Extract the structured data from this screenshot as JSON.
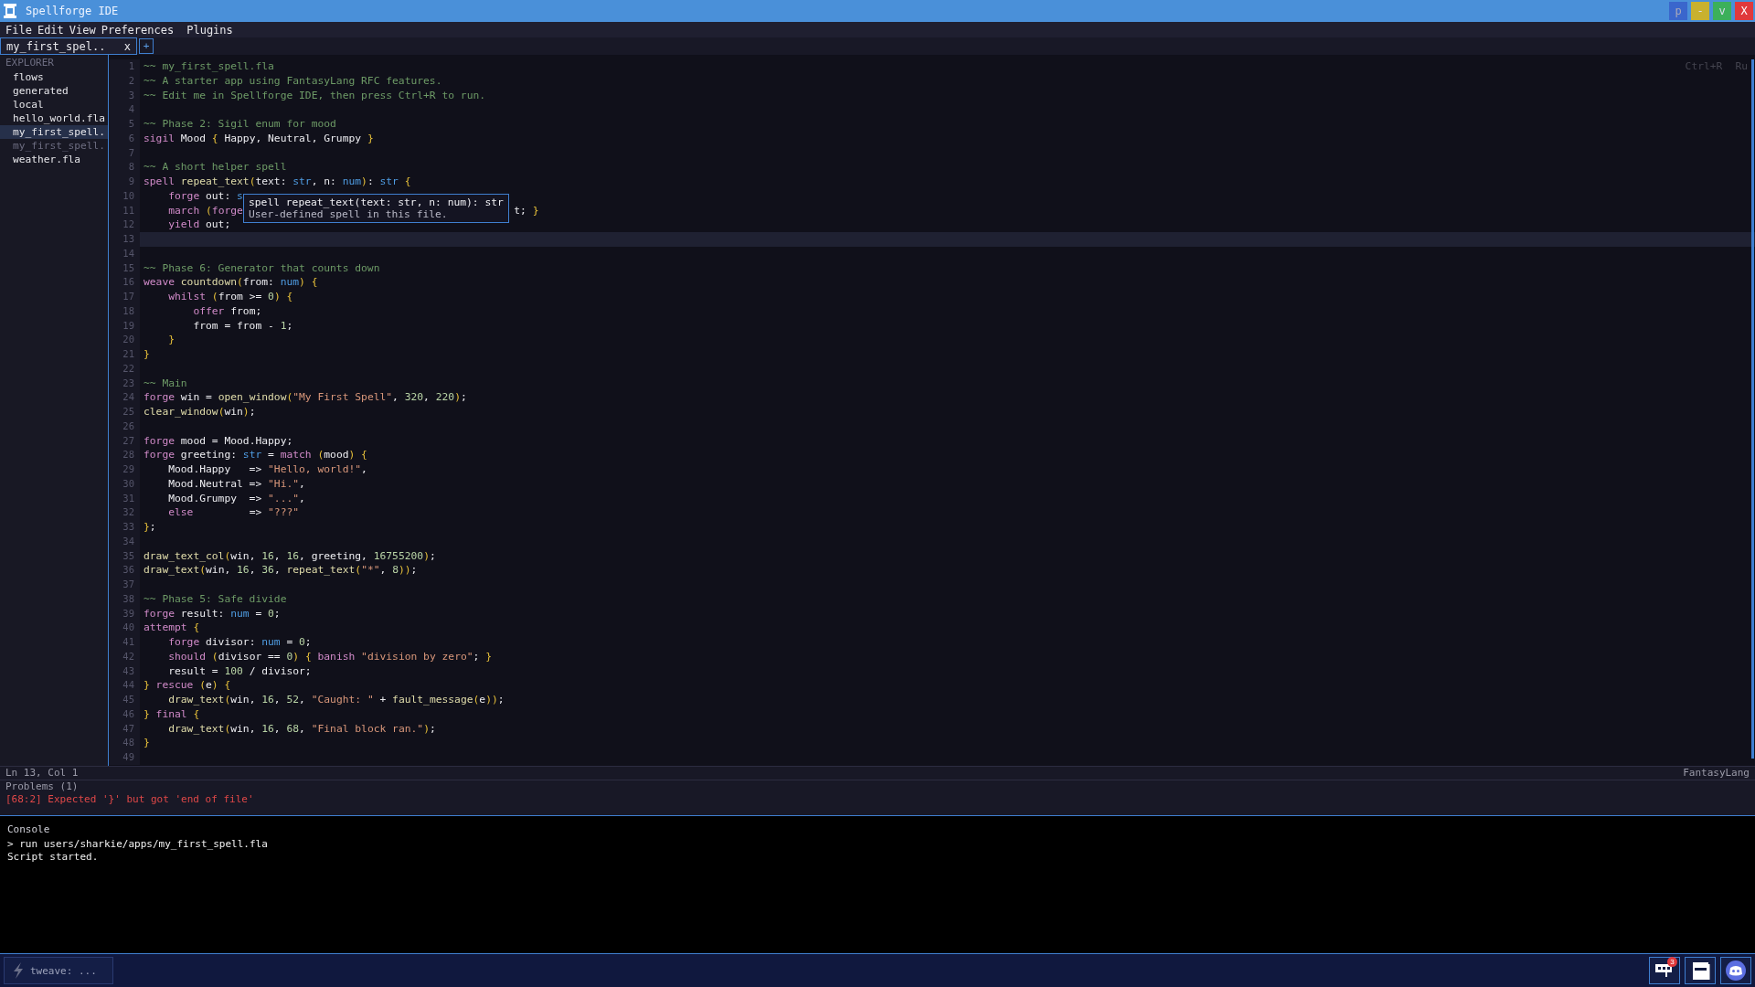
{
  "window": {
    "title": "Spellforge IDE",
    "controls": [
      {
        "kind": "pin",
        "label": "p"
      },
      {
        "kind": "minimize",
        "label": "-"
      },
      {
        "kind": "maximize",
        "label": "v"
      },
      {
        "kind": "close",
        "label": "X"
      }
    ]
  },
  "menu": [
    "File",
    "Edit",
    "View",
    "Preferences",
    "Plugins"
  ],
  "tabs": [
    {
      "label": "my_first_spel..",
      "close": "x",
      "selected": true
    }
  ],
  "new_tab": "+",
  "explorer": {
    "title": "EXPLORER",
    "items": [
      {
        "label": "flows",
        "selected": false,
        "muted": false
      },
      {
        "label": "generated",
        "selected": false,
        "muted": false
      },
      {
        "label": "local",
        "selected": false,
        "muted": false
      },
      {
        "label": "hello_world.fla",
        "selected": false,
        "muted": false
      },
      {
        "label": "my_first_spell.",
        "selected": true,
        "muted": false
      },
      {
        "label": "my_first_spell.",
        "selected": false,
        "muted": true
      },
      {
        "label": "weather.fla",
        "selected": false,
        "muted": false
      }
    ]
  },
  "editor": {
    "hint": {
      "keys": "Ctrl+R",
      "action": "Ru"
    },
    "lines": [
      {
        "number": "1",
        "current": false,
        "tokens": [
          {
            "kind": "c",
            "text": "~~ my_first_spell.fla"
          }
        ]
      },
      {
        "number": "2",
        "current": false,
        "tokens": [
          {
            "kind": "c",
            "text": "~~ A starter app using FantasyLang RFC features."
          }
        ]
      },
      {
        "number": "3",
        "current": false,
        "tokens": [
          {
            "kind": "c",
            "text": "~~ Edit me in Spellforge IDE, then press Ctrl+R to run."
          }
        ]
      },
      {
        "number": "4",
        "current": false
      },
      {
        "number": "5",
        "current": false,
        "tokens": [
          {
            "kind": "c",
            "text": "~~ Phase 2: Sigil enum for mood"
          }
        ]
      },
      {
        "number": "6",
        "current": false,
        "tokens": [
          {
            "kind": "kw",
            "text": "sigil"
          },
          {
            "kind": "p",
            "text": " Mood "
          },
          {
            "kind": "br",
            "text": "{"
          },
          {
            "kind": "p",
            "text": " Happy, Neutral, Grumpy "
          },
          {
            "kind": "br",
            "text": "}"
          }
        ]
      },
      {
        "number": "7",
        "current": false
      },
      {
        "number": "8",
        "current": false,
        "tokens": [
          {
            "kind": "c",
            "text": "~~ A short helper spell"
          }
        ]
      },
      {
        "number": "9",
        "current": false,
        "tokens": [
          {
            "kind": "kw",
            "text": "spell "
          },
          {
            "kind": "fn",
            "text": "repeat_text"
          },
          {
            "kind": "br",
            "text": "("
          },
          {
            "kind": "p",
            "text": "text: "
          },
          {
            "kind": "ty",
            "text": "str"
          },
          {
            "kind": "p",
            "text": ", n: "
          },
          {
            "kind": "ty",
            "text": "num"
          },
          {
            "kind": "br",
            "text": ")"
          },
          {
            "kind": "p",
            "text": ": "
          },
          {
            "kind": "ty",
            "text": "str "
          },
          {
            "kind": "br",
            "text": "{"
          }
        ]
      },
      {
        "number": "10",
        "current": false,
        "tokens": [
          {
            "kind": "kw",
            "text": "    forge"
          },
          {
            "kind": "p",
            "text": " out: "
          },
          {
            "kind": "ty",
            "text": "s"
          }
        ]
      },
      {
        "number": "11",
        "current": false,
        "tokens": [
          {
            "kind": "kw",
            "text": "    march "
          },
          {
            "kind": "br",
            "text": "("
          },
          {
            "kind": "kw",
            "text": "forge"
          },
          {
            "kind": "gap"
          },
          {
            "kind": "p",
            "text": "t; "
          },
          {
            "kind": "br",
            "text": "}"
          }
        ]
      },
      {
        "number": "12",
        "current": false,
        "tokens": [
          {
            "kind": "kw",
            "text": "    yield"
          },
          {
            "kind": "p",
            "text": " out;"
          }
        ]
      },
      {
        "number": "13",
        "current": true
      },
      {
        "number": "14",
        "current": false
      },
      {
        "number": "15",
        "current": false,
        "tokens": [
          {
            "kind": "c",
            "text": "~~ Phase 6: Generator that counts down"
          }
        ]
      },
      {
        "number": "16",
        "current": false,
        "tokens": [
          {
            "kind": "kw",
            "text": "weave "
          },
          {
            "kind": "fn",
            "text": "countdown"
          },
          {
            "kind": "br",
            "text": "("
          },
          {
            "kind": "p",
            "text": "from: "
          },
          {
            "kind": "ty",
            "text": "num"
          },
          {
            "kind": "br",
            "text": ") {"
          }
        ]
      },
      {
        "number": "17",
        "current": false,
        "tokens": [
          {
            "kind": "kw",
            "text": "    whilst "
          },
          {
            "kind": "br",
            "text": "("
          },
          {
            "kind": "p",
            "text": "from >= "
          },
          {
            "kind": "nu",
            "text": "0"
          },
          {
            "kind": "br",
            "text": ") {"
          }
        ]
      },
      {
        "number": "18",
        "current": false,
        "tokens": [
          {
            "kind": "kw",
            "text": "        offer"
          },
          {
            "kind": "p",
            "text": " from;"
          }
        ]
      },
      {
        "number": "19",
        "current": false,
        "tokens": [
          {
            "kind": "p",
            "text": "        from = from - "
          },
          {
            "kind": "nu",
            "text": "1"
          },
          {
            "kind": "p",
            "text": ";"
          }
        ]
      },
      {
        "number": "20",
        "current": false,
        "tokens": [
          {
            "kind": "br",
            "text": "    }"
          }
        ]
      },
      {
        "number": "21",
        "current": false,
        "tokens": [
          {
            "kind": "br",
            "text": "}"
          }
        ]
      },
      {
        "number": "22",
        "current": false
      },
      {
        "number": "23",
        "current": false,
        "tokens": [
          {
            "kind": "c",
            "text": "~~ Main"
          }
        ]
      },
      {
        "number": "24",
        "current": false,
        "tokens": [
          {
            "kind": "kw",
            "text": "forge"
          },
          {
            "kind": "p",
            "text": " win = "
          },
          {
            "kind": "fn",
            "text": "open_window"
          },
          {
            "kind": "br",
            "text": "("
          },
          {
            "kind": "st",
            "text": "\"My First Spell\""
          },
          {
            "kind": "p",
            "text": ", "
          },
          {
            "kind": "nu",
            "text": "320"
          },
          {
            "kind": "p",
            "text": ", "
          },
          {
            "kind": "nu",
            "text": "220"
          },
          {
            "kind": "br",
            "text": ")"
          },
          {
            "kind": "p",
            "text": ";"
          }
        ]
      },
      {
        "number": "25",
        "current": false,
        "tokens": [
          {
            "kind": "fn",
            "text": "clear_window"
          },
          {
            "kind": "br",
            "text": "("
          },
          {
            "kind": "p",
            "text": "win"
          },
          {
            "kind": "br",
            "text": ")"
          },
          {
            "kind": "p",
            "text": ";"
          }
        ]
      },
      {
        "number": "26",
        "current": false
      },
      {
        "number": "27",
        "current": false,
        "tokens": [
          {
            "kind": "kw",
            "text": "forge"
          },
          {
            "kind": "p",
            "text": " mood = Mood.Happy;"
          }
        ]
      },
      {
        "number": "28",
        "current": false,
        "tokens": [
          {
            "kind": "kw",
            "text": "forge"
          },
          {
            "kind": "p",
            "text": " greeting: "
          },
          {
            "kind": "ty",
            "text": "str"
          },
          {
            "kind": "p",
            "text": " = "
          },
          {
            "kind": "kw",
            "text": "match "
          },
          {
            "kind": "br",
            "text": "("
          },
          {
            "kind": "p",
            "text": "mood"
          },
          {
            "kind": "br",
            "text": ") {"
          }
        ]
      },
      {
        "number": "29",
        "current": false,
        "tokens": [
          {
            "kind": "p",
            "text": "    Mood.Happy   => "
          },
          {
            "kind": "st",
            "text": "\"Hello, world!\""
          },
          {
            "kind": "p",
            "text": ","
          }
        ]
      },
      {
        "number": "30",
        "current": false,
        "tokens": [
          {
            "kind": "p",
            "text": "    Mood.Neutral => "
          },
          {
            "kind": "st",
            "text": "\"Hi.\""
          },
          {
            "kind": "p",
            "text": ","
          }
        ]
      },
      {
        "number": "31",
        "current": false,
        "tokens": [
          {
            "kind": "p",
            "text": "    Mood.Grumpy  => "
          },
          {
            "kind": "st",
            "text": "\"...\""
          },
          {
            "kind": "p",
            "text": ","
          }
        ]
      },
      {
        "number": "32",
        "current": false,
        "tokens": [
          {
            "kind": "kw",
            "text": "    else"
          },
          {
            "kind": "p",
            "text": "         => "
          },
          {
            "kind": "st",
            "text": "\"???\""
          }
        ]
      },
      {
        "number": "33",
        "current": false,
        "tokens": [
          {
            "kind": "br",
            "text": "}"
          },
          {
            "kind": "p",
            "text": ";"
          }
        ]
      },
      {
        "number": "34",
        "current": false
      },
      {
        "number": "35",
        "current": false,
        "tokens": [
          {
            "kind": "fn",
            "text": "draw_text_col"
          },
          {
            "kind": "br",
            "text": "("
          },
          {
            "kind": "p",
            "text": "win, "
          },
          {
            "kind": "nu",
            "text": "16"
          },
          {
            "kind": "p",
            "text": ", "
          },
          {
            "kind": "nu",
            "text": "16"
          },
          {
            "kind": "p",
            "text": ", greeting, "
          },
          {
            "kind": "nu",
            "text": "16755200"
          },
          {
            "kind": "br",
            "text": ")"
          },
          {
            "kind": "p",
            "text": ";"
          }
        ]
      },
      {
        "number": "36",
        "current": false,
        "tokens": [
          {
            "kind": "fn",
            "text": "draw_text"
          },
          {
            "kind": "br",
            "text": "("
          },
          {
            "kind": "p",
            "text": "win, "
          },
          {
            "kind": "nu",
            "text": "16"
          },
          {
            "kind": "p",
            "text": ", "
          },
          {
            "kind": "nu",
            "text": "36"
          },
          {
            "kind": "p",
            "text": ", "
          },
          {
            "kind": "fn",
            "text": "repeat_text"
          },
          {
            "kind": "br",
            "text": "("
          },
          {
            "kind": "st",
            "text": "\"*\""
          },
          {
            "kind": "p",
            "text": ", "
          },
          {
            "kind": "nu",
            "text": "8"
          },
          {
            "kind": "br",
            "text": "))"
          },
          {
            "kind": "p",
            "text": ";"
          }
        ]
      },
      {
        "number": "37",
        "current": false
      },
      {
        "number": "38",
        "current": false,
        "tokens": [
          {
            "kind": "c",
            "text": "~~ Phase 5: Safe divide"
          }
        ]
      },
      {
        "number": "39",
        "current": false,
        "tokens": [
          {
            "kind": "kw",
            "text": "forge"
          },
          {
            "kind": "p",
            "text": " result: "
          },
          {
            "kind": "ty",
            "text": "num"
          },
          {
            "kind": "p",
            "text": " = "
          },
          {
            "kind": "nu",
            "text": "0"
          },
          {
            "kind": "p",
            "text": ";"
          }
        ]
      },
      {
        "number": "40",
        "current": false,
        "tokens": [
          {
            "kind": "kw",
            "text": "attempt "
          },
          {
            "kind": "br",
            "text": "{"
          }
        ]
      },
      {
        "number": "41",
        "current": false,
        "tokens": [
          {
            "kind": "kw",
            "text": "    forge"
          },
          {
            "kind": "p",
            "text": " divisor: "
          },
          {
            "kind": "ty",
            "text": "num"
          },
          {
            "kind": "p",
            "text": " = "
          },
          {
            "kind": "nu",
            "text": "0"
          },
          {
            "kind": "p",
            "text": ";"
          }
        ]
      },
      {
        "number": "42",
        "current": false,
        "tokens": [
          {
            "kind": "kw",
            "text": "    should "
          },
          {
            "kind": "br",
            "text": "("
          },
          {
            "kind": "p",
            "text": "divisor == "
          },
          {
            "kind": "nu",
            "text": "0"
          },
          {
            "kind": "br",
            "text": ") { "
          },
          {
            "kind": "kw",
            "text": "banish "
          },
          {
            "kind": "st",
            "text": "\"division by zero\""
          },
          {
            "kind": "p",
            "text": "; "
          },
          {
            "kind": "br",
            "text": "}"
          }
        ]
      },
      {
        "number": "43",
        "current": false,
        "tokens": [
          {
            "kind": "p",
            "text": "    result = "
          },
          {
            "kind": "nu",
            "text": "100"
          },
          {
            "kind": "p",
            "text": " / divisor;"
          }
        ]
      },
      {
        "number": "44",
        "current": false,
        "tokens": [
          {
            "kind": "br",
            "text": "} "
          },
          {
            "kind": "kw",
            "text": "rescue "
          },
          {
            "kind": "br",
            "text": "("
          },
          {
            "kind": "p",
            "text": "e"
          },
          {
            "kind": "br",
            "text": ") {"
          }
        ]
      },
      {
        "number": "45",
        "current": false,
        "tokens": [
          {
            "kind": "fn",
            "text": "    draw_text"
          },
          {
            "kind": "br",
            "text": "("
          },
          {
            "kind": "p",
            "text": "win, "
          },
          {
            "kind": "nu",
            "text": "16"
          },
          {
            "kind": "p",
            "text": ", "
          },
          {
            "kind": "nu",
            "text": "52"
          },
          {
            "kind": "p",
            "text": ", "
          },
          {
            "kind": "st",
            "text": "\"Caught: \""
          },
          {
            "kind": "p",
            "text": " + "
          },
          {
            "kind": "fn",
            "text": "fault_message"
          },
          {
            "kind": "br",
            "text": "("
          },
          {
            "kind": "p",
            "text": "e"
          },
          {
            "kind": "br",
            "text": "))"
          },
          {
            "kind": "p",
            "text": ";"
          }
        ]
      },
      {
        "number": "46",
        "current": false,
        "tokens": [
          {
            "kind": "br",
            "text": "} "
          },
          {
            "kind": "kw",
            "text": "final "
          },
          {
            "kind": "br",
            "text": "{"
          }
        ]
      },
      {
        "number": "47",
        "current": false,
        "tokens": [
          {
            "kind": "fn",
            "text": "    draw_text"
          },
          {
            "kind": "br",
            "text": "("
          },
          {
            "kind": "p",
            "text": "win, "
          },
          {
            "kind": "nu",
            "text": "16"
          },
          {
            "kind": "p",
            "text": ", "
          },
          {
            "kind": "nu",
            "text": "68"
          },
          {
            "kind": "p",
            "text": ", "
          },
          {
            "kind": "st",
            "text": "\"Final block ran.\""
          },
          {
            "kind": "br",
            "text": ")"
          },
          {
            "kind": "p",
            "text": ";"
          }
        ]
      },
      {
        "number": "48",
        "current": false,
        "tokens": [
          {
            "kind": "br",
            "text": "}"
          }
        ]
      },
      {
        "number": "49",
        "current": false
      }
    ],
    "tooltip": {
      "signature": "spell repeat_text(text: str, n: num): str",
      "description": "User-defined spell in this file."
    }
  },
  "status_bar": {
    "position": "Ln 13, Col 1",
    "language": "FantasyLang"
  },
  "problems": {
    "title": "Problems (1)",
    "items": [
      "[68:2] Expected '}' but got 'end of file'"
    ]
  },
  "console": {
    "title": "Console",
    "lines": [
      "> run users/sharkie/apps/my_first_spell.fla",
      "Script started."
    ]
  },
  "taskbar": {
    "task": "tweave: ...",
    "tray": [
      {
        "kind": "chat",
        "badge": "3"
      },
      {
        "kind": "window"
      },
      {
        "kind": "controller"
      }
    ]
  }
}
